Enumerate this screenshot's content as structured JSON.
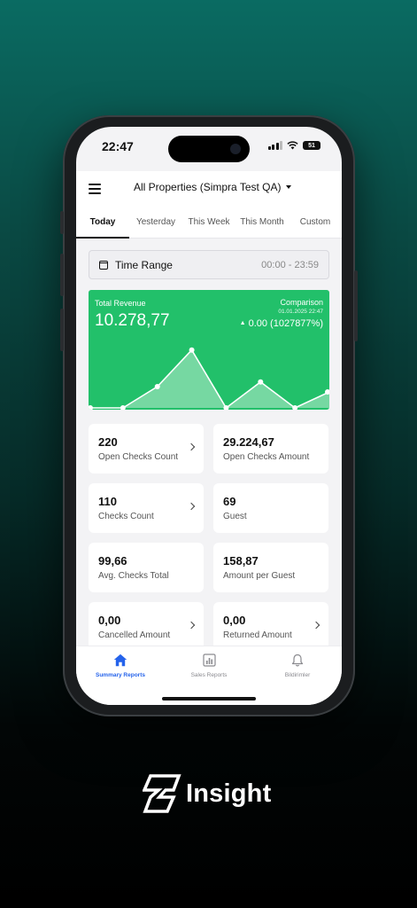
{
  "status_bar": {
    "time": "22:47",
    "battery": "51"
  },
  "header": {
    "property_title": "All Properties (Simpra Test QA)"
  },
  "tabs": [
    {
      "label": "Today",
      "active": true
    },
    {
      "label": "Yesterday",
      "active": false
    },
    {
      "label": "This Week",
      "active": false
    },
    {
      "label": "This Month",
      "active": false
    },
    {
      "label": "Custom",
      "active": false
    }
  ],
  "time_range": {
    "label": "Time Range",
    "value": "00:00 - 23:59"
  },
  "revenue": {
    "label": "Total Revenue",
    "value": "10.278,77",
    "comparison_label": "Comparison",
    "comparison_date": "01.01.2025 22:47",
    "comparison_value": "0.00 (1027877%)"
  },
  "stats": [
    {
      "value": "220",
      "label": "Open Checks Count",
      "chevron": true
    },
    {
      "value": "29.224,67",
      "label": "Open Checks Amount",
      "chevron": false
    },
    {
      "value": "110",
      "label": "Checks Count",
      "chevron": true
    },
    {
      "value": "69",
      "label": "Guest",
      "chevron": false
    },
    {
      "value": "99,66",
      "label": "Avg. Checks Total",
      "chevron": false
    },
    {
      "value": "158,87",
      "label": "Amount per Guest",
      "chevron": false
    },
    {
      "value": "0,00",
      "label": "Cancelled Amount",
      "chevron": true
    },
    {
      "value": "0,00",
      "label": "Returned Amount",
      "chevron": true
    }
  ],
  "bottom_nav": [
    {
      "label": "Summary Reports",
      "icon": "home-icon",
      "active": true
    },
    {
      "label": "Sales Reports",
      "icon": "bar-chart-icon",
      "active": false
    },
    {
      "label": "Bildirimler",
      "icon": "bell-icon",
      "active": false
    }
  ],
  "brand": {
    "name": "Insight"
  },
  "colors": {
    "accent_green": "#22c06a",
    "nav_active": "#2563eb"
  },
  "chart_data": {
    "type": "area",
    "x": [
      0,
      1,
      2,
      3,
      4,
      5,
      6,
      7
    ],
    "values": [
      0,
      0,
      0.32,
      0.87,
      0,
      0.39,
      0,
      0.24
    ],
    "ylim": [
      0,
      1
    ]
  }
}
